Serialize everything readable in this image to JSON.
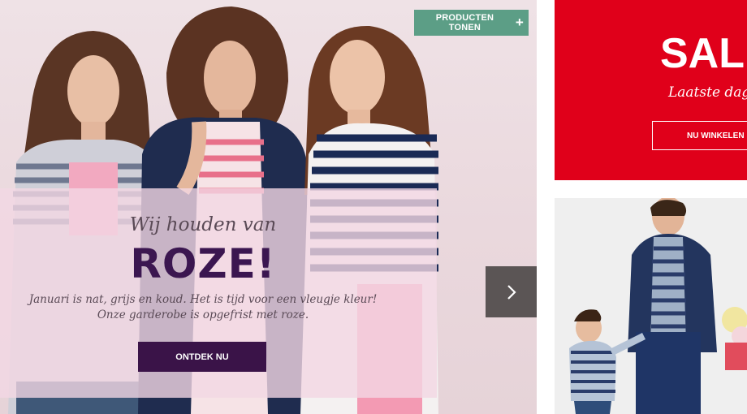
{
  "hero": {
    "products_button_label": "PRODUCTEN TONEN",
    "products_button_icon": "plus-icon",
    "promo": {
      "eyebrow": "Wij houden van",
      "title": "ROZE!",
      "text_line1": "Januari is nat, grijs en koud. Het is tijd voor een vleugje kleur!",
      "text_line2": "Onze garderobe is opgefrist met roze.",
      "cta_label": "ONTDEK NU"
    },
    "slider_next_icon": "chevron-right-icon"
  },
  "sale_tile": {
    "heading": "SAL",
    "subtitle": "Laatste dag",
    "cta_label": "NU WINKELEN"
  },
  "colors": {
    "products_button": "#5c9e86",
    "promo_title": "#3b1650",
    "discover_button": "#3a1348",
    "promo_panel": "#f3d7e4",
    "sale_background": "#e0001a",
    "slider_arrow_bg": "#5b5555"
  }
}
